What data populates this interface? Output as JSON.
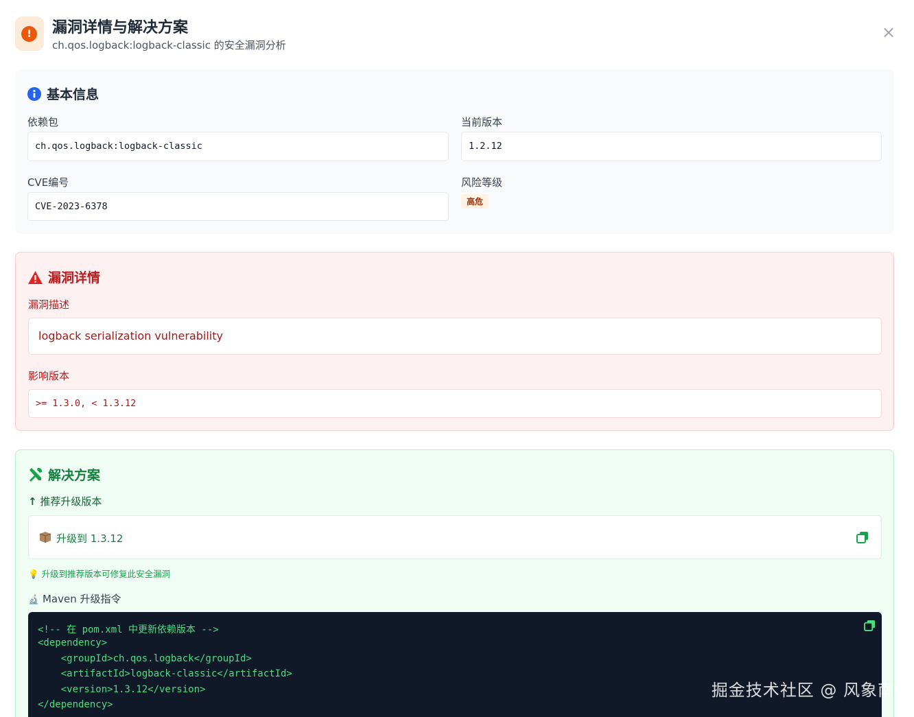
{
  "dialog": {
    "title": "漏洞详情与解决方案",
    "subtitle": "ch.qos.logback:logback-classic 的安全漏洞分析",
    "close_label": "×"
  },
  "basic_info": {
    "title": "基本信息",
    "dependency_label": "依赖包",
    "dependency_value": "ch.qos.logback:logback-classic",
    "version_label": "当前版本",
    "version_value": "1.2.12",
    "cve_label": "CVE编号",
    "cve_value": "CVE-2023-6378",
    "risk_label": "风险等级",
    "risk_value": "高危"
  },
  "vuln_detail": {
    "title": "漏洞详情",
    "desc_label": "漏洞描述",
    "desc_value": "logback serialization vulnerability",
    "affected_label": "影响版本",
    "affected_value": ">= 1.3.0, < 1.3.12"
  },
  "solution": {
    "title": "解决方案",
    "recommend_label": "推荐升级版本",
    "upgrade_text": "升级到 1.3.12",
    "hint": "升级到推荐版本可修复此安全漏洞",
    "maven_label": "Maven 升级指令",
    "code_lines": [
      "<!-- 在 pom.xml 中更新依赖版本 -->",
      "<dependency>",
      "    <groupId>ch.qos.logback</groupId>",
      "    <artifactId>logback-classic</artifactId>",
      "    <version>1.3.12</version>",
      "</dependency>"
    ]
  },
  "watermark": "掘金技术社区 @ 风象南",
  "colors": {
    "accent_orange": "#ea580c",
    "info_blue": "#2563eb",
    "danger_red": "#dc2626",
    "success_green": "#16a34a",
    "code_bg": "#111827"
  }
}
